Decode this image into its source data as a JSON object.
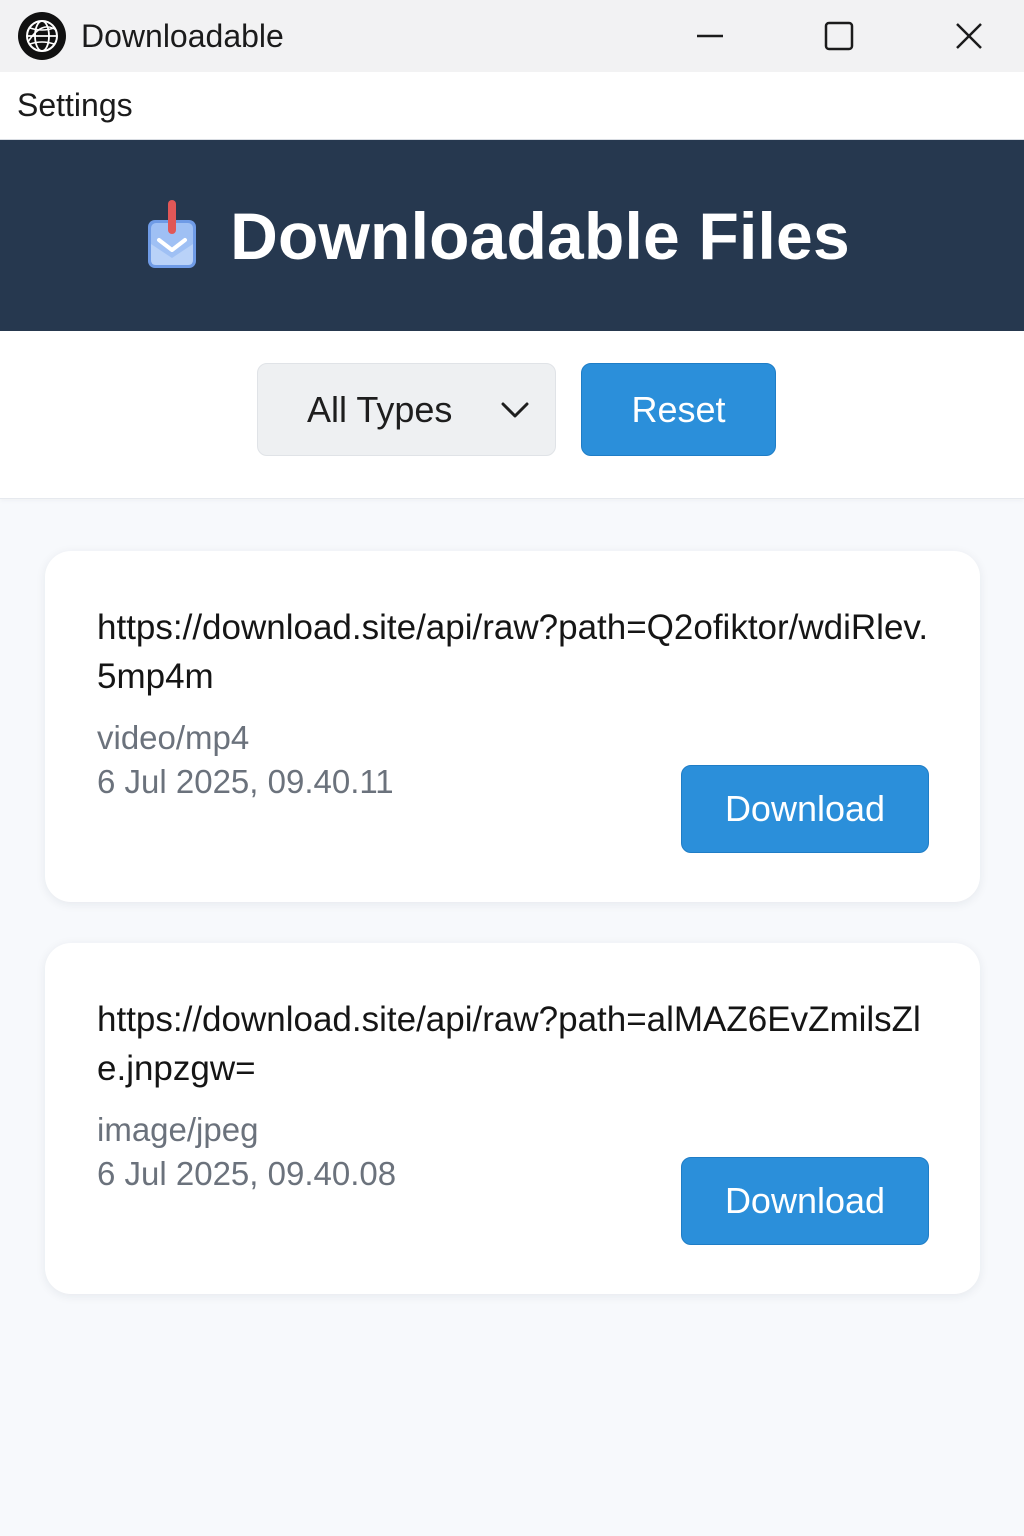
{
  "window": {
    "title": "Downloadable",
    "app_icon": "globe-icon"
  },
  "menu": {
    "settings_label": "Settings"
  },
  "header": {
    "title": "Downloadable Files",
    "icon": "download-tray-icon"
  },
  "filters": {
    "type_selected": "All Types",
    "reset_label": "Reset"
  },
  "files": [
    {
      "url": "https://download.site/api/raw?path=Q2ofiktor/wdiRlev.5mp4m",
      "type": "video/mp4",
      "date": "6 Jul 2025, 09.40.11",
      "download_label": "Download"
    },
    {
      "url": "https://download.site/api/raw?path=alMAZ6EvZmilsZle.jnpzgw=",
      "type": "image/jpeg",
      "date": "6 Jul 2025, 09.40.08",
      "download_label": "Download"
    }
  ],
  "colors": {
    "header_bg": "#26384f",
    "accent": "#2b8fda",
    "muted_text": "#6b727c"
  }
}
